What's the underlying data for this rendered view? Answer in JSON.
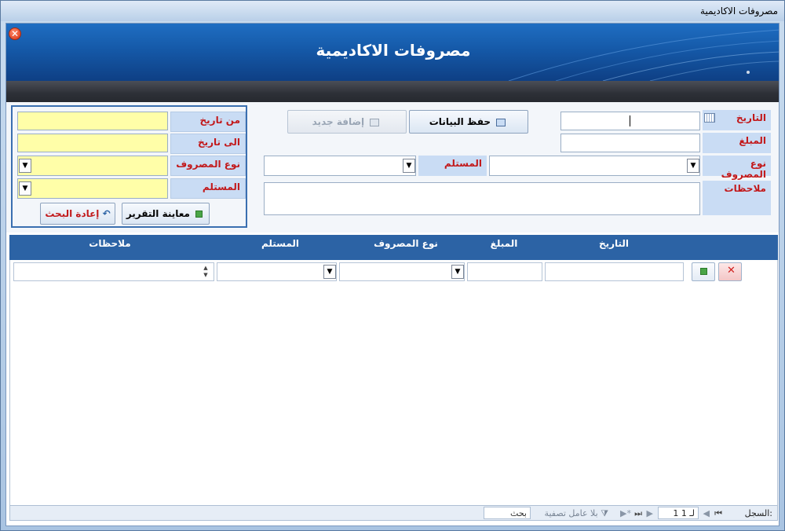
{
  "window": {
    "title": "مصروفات الاكاديمية"
  },
  "banner": {
    "title": "مصروفات الاكاديمية",
    "close_glyph": "✕"
  },
  "form": {
    "date_label": "التاريخ",
    "amount_label": "المبلغ",
    "expense_type_label": "نوع المصروف",
    "receiver_label": "المستلم",
    "notes_label": "ملاحظات",
    "save_button": "حفظ البيانات",
    "add_new_button": "إضافة جديد"
  },
  "search": {
    "from_date_label": "من تاريخ",
    "to_date_label": "الى تاريخ",
    "expense_type_label": "نوع المصروف",
    "receiver_label": "المستلم",
    "preview_report_button": "معاينة التقرير",
    "reset_search_button": "إعادة البحث"
  },
  "grid": {
    "columns": [
      "التاريخ",
      "المبلغ",
      "نوع المصروف",
      "المستلم",
      "ملاحظات"
    ]
  },
  "navigation": {
    "record_label": "السجل:",
    "record_value": "1 لـ 1",
    "filter_label": "بلا عامل تصفية",
    "search_placeholder": "بحث"
  },
  "icons": {
    "calendar": "calendar-icon",
    "dropdown": "▼",
    "spin_up": "▲",
    "spin_down": "▼"
  },
  "colors": {
    "label_bg": "#c9dcf4",
    "label_text": "#c2191b",
    "search_field_bg": "#fffea8",
    "grid_header_bg": "#2c63a5",
    "banner_bg": "#1559a8"
  }
}
